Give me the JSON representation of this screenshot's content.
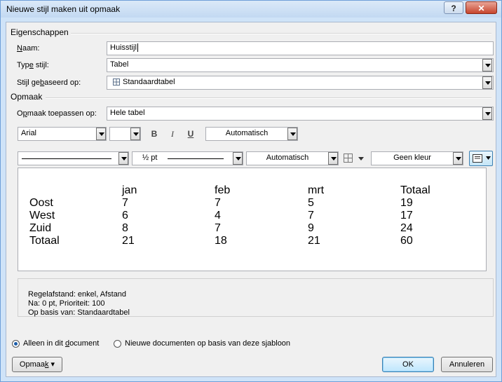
{
  "window": {
    "title": "Nieuwe stijl maken uit opmaak",
    "help_label": "?",
    "close_label": "✕"
  },
  "properties": {
    "section_label": "Eigenschappen",
    "name_label_u": "N",
    "name_label_rest": "aam:",
    "name_value": "Huisstijl",
    "type_label_pre": "Typ",
    "type_label_u": "e",
    "type_label_rest": " stijl:",
    "type_value": "Tabel",
    "based_label_pre": "Stijl ge",
    "based_label_u": "b",
    "based_label_rest": "aseerd op:",
    "based_value": "Standaardtabel",
    "based_icon": "table-icon"
  },
  "format": {
    "section_label": "Opmaak",
    "apply_label_pre": "O",
    "apply_label_u": "p",
    "apply_label_rest": "maak toepassen op:",
    "apply_value": "Hele tabel",
    "font_value": "Arial",
    "size_value": "",
    "bold_label": "B",
    "italic_label": "I",
    "underline_label": "U",
    "font_color_value": "Automatisch",
    "border_weight_value": "½ pt",
    "border_color_value": "Automatisch",
    "shading_value": "Geen kleur"
  },
  "preview": {
    "headers": [
      "",
      "jan",
      "feb",
      "mrt",
      "Totaal"
    ],
    "rows": [
      [
        "Oost",
        "7",
        "7",
        "5",
        "19"
      ],
      [
        "West",
        "6",
        "4",
        "7",
        "17"
      ],
      [
        "Zuid",
        "8",
        "7",
        "9",
        "24"
      ],
      [
        "Totaal",
        "21",
        "18",
        "21",
        "60"
      ]
    ]
  },
  "description": {
    "line1": "Regelafstand:  enkel, Afstand",
    "line2": "Na:  0 pt, Prioriteit: 100",
    "line3": "Op basis van: Standaardtabel"
  },
  "scope": {
    "option1_pre": "Alleen in dit ",
    "option1_u": "d",
    "option1_rest": "ocument",
    "option2": "Nieuwe documenten op basis van deze sjabloon",
    "selected": "option1"
  },
  "buttons": {
    "format_pre": "Opmaa",
    "format_u": "k",
    "format_arrow": "▾",
    "ok": "OK",
    "cancel": "Annuleren"
  }
}
